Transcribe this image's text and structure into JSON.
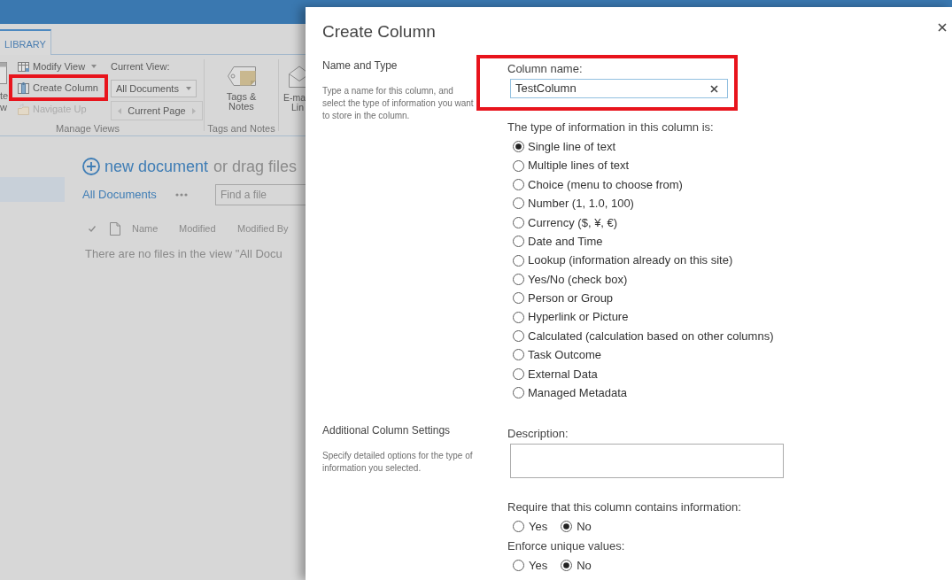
{
  "background_page": {
    "ribbon": {
      "tabs": [
        {
          "label": "LIBRARY",
          "selected": true
        }
      ],
      "groups": {
        "manage_views": {
          "label": "Manage Views",
          "large_button": {
            "label_lines": [
              "te",
              "w"
            ]
          },
          "commands": [
            {
              "label": "Modify View",
              "has_menu": true,
              "disabled": false,
              "highlighted": false
            },
            {
              "label": "Create Column",
              "has_menu": false,
              "disabled": false,
              "highlighted": true
            },
            {
              "label": "Navigate Up",
              "has_menu": false,
              "disabled": true,
              "highlighted": false
            }
          ],
          "current_view_label": "Current View:",
          "current_view": "All Documents",
          "pager_label": "Current Page"
        },
        "tags_and_notes": {
          "label": "Tags and Notes",
          "button_lines": [
            "Tags &",
            "Notes"
          ]
        },
        "group_3": {
          "button_lines": [
            "E-ma",
            "Lin"
          ]
        }
      }
    },
    "new_document": {
      "link": "new document",
      "hint": "or drag files"
    },
    "view_link": "All Documents",
    "search": {
      "placeholder": "Find a file"
    },
    "columns": [
      "Name",
      "Modified",
      "Modified By"
    ],
    "empty_message": "There are no files in the view \"All Docu"
  },
  "dialog": {
    "title": "Create Column",
    "sections": [
      {
        "heading": "Name and Type",
        "description": "Type a name for this column, and select the type of information you want to store in the column.",
        "fields": [
          {
            "kind": "text",
            "label": "Column name:",
            "value": "TestColumn",
            "highlighted": true
          },
          {
            "kind": "radio_list",
            "label": "The type of information in this column is:",
            "options": [
              {
                "label": "Single line of text",
                "selected": true
              },
              {
                "label": "Multiple lines of text",
                "selected": false
              },
              {
                "label": "Choice (menu to choose from)",
                "selected": false
              },
              {
                "label": "Number (1, 1.0, 100)",
                "selected": false
              },
              {
                "label": "Currency ($, ¥, €)",
                "selected": false
              },
              {
                "label": "Date and Time",
                "selected": false
              },
              {
                "label": "Lookup (information already on this site)",
                "selected": false
              },
              {
                "label": "Yes/No (check box)",
                "selected": false
              },
              {
                "label": "Person or Group",
                "selected": false
              },
              {
                "label": "Hyperlink or Picture",
                "selected": false
              },
              {
                "label": "Calculated (calculation based on other columns)",
                "selected": false
              },
              {
                "label": "Task Outcome",
                "selected": false
              },
              {
                "label": "External Data",
                "selected": false
              },
              {
                "label": "Managed Metadata",
                "selected": false
              }
            ]
          }
        ]
      },
      {
        "heading": "Additional Column Settings",
        "description": "Specify detailed options for the type of information you selected.",
        "fields": [
          {
            "kind": "textarea",
            "label": "Description:"
          },
          {
            "kind": "radio_row",
            "label": "Require that this column contains information:",
            "options": [
              {
                "label": "Yes",
                "selected": false
              },
              {
                "label": "No",
                "selected": true
              }
            ]
          },
          {
            "kind": "radio_row",
            "label": "Enforce unique values:",
            "options": [
              {
                "label": "Yes",
                "selected": false
              },
              {
                "label": "No",
                "selected": true
              }
            ]
          }
        ]
      }
    ]
  }
}
